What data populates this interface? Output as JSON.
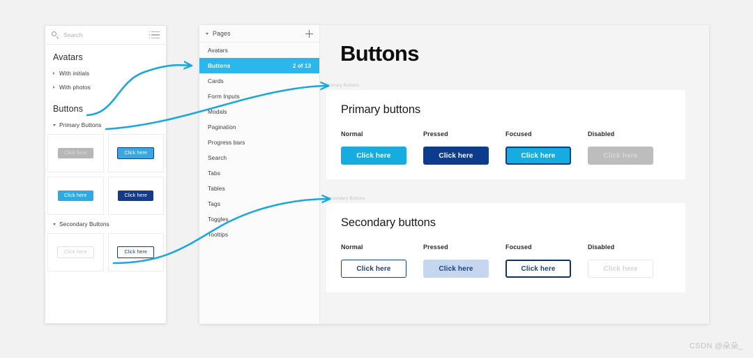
{
  "colors": {
    "accent_cyan": "#16ace0",
    "selected_row": "#2bb6ec",
    "navy": "#0d3c8f",
    "secondary_navy": "#1b3f7e",
    "disabled_gray": "#bdbdbd",
    "arrow": "#1ba7dd",
    "canvas": "#f2f2f2"
  },
  "left_panel": {
    "search": {
      "placeholder": "Search",
      "icon": "search-icon",
      "list_icon": "list-view-icon"
    },
    "groups": [
      {
        "title": "Avatars",
        "items": [
          {
            "label": "With initials",
            "caret": "right"
          },
          {
            "label": "With photos",
            "caret": "right"
          }
        ]
      },
      {
        "title": "Buttons",
        "items": [
          {
            "label": "Primary Buttons",
            "caret": "down"
          },
          {
            "label": "Secondary Buttons",
            "caret": "down"
          }
        ]
      }
    ],
    "thumbnails": {
      "primary": [
        {
          "label": "Click here",
          "state": "disabled"
        },
        {
          "label": "Click here",
          "state": "focused"
        },
        {
          "label": "Click here",
          "state": "normal"
        },
        {
          "label": "Click here",
          "state": "pressed"
        }
      ],
      "secondary": [
        {
          "label": "Click here",
          "state": "disabled"
        },
        {
          "label": "Click here",
          "state": "focused"
        }
      ]
    }
  },
  "pages_pane": {
    "header": {
      "title": "Pages",
      "add_icon": "plus-icon",
      "collapse_icon": "caret-down-icon"
    },
    "items": [
      {
        "label": "Avatars",
        "count": "",
        "selected": false
      },
      {
        "label": "Buttons",
        "count": "2 of 13",
        "selected": true
      },
      {
        "label": "Cards",
        "count": "",
        "selected": false
      },
      {
        "label": "Form Inputs",
        "count": "",
        "selected": false
      },
      {
        "label": "Modals",
        "count": "",
        "selected": false
      },
      {
        "label": "Pagination",
        "count": "",
        "selected": false
      },
      {
        "label": "Progress bars",
        "count": "",
        "selected": false
      },
      {
        "label": "Search",
        "count": "",
        "selected": false
      },
      {
        "label": "Tabs",
        "count": "",
        "selected": false
      },
      {
        "label": "Tables",
        "count": "",
        "selected": false
      },
      {
        "label": "Tags",
        "count": "",
        "selected": false
      },
      {
        "label": "Toggles",
        "count": "",
        "selected": false
      },
      {
        "label": "Tooltips",
        "count": "",
        "selected": false
      }
    ]
  },
  "content": {
    "title": "Buttons",
    "sections": [
      {
        "tag": "Primary Buttons",
        "heading": "Primary buttons",
        "states": [
          {
            "label": "Normal",
            "button": "Click here",
            "style": "p-normal"
          },
          {
            "label": "Pressed",
            "button": "Click here",
            "style": "p-pressed"
          },
          {
            "label": "Focused",
            "button": "Click here",
            "style": "p-focused"
          },
          {
            "label": "Disabled",
            "button": "Click here",
            "style": "p-disabled"
          }
        ]
      },
      {
        "tag": "Secondary Buttons",
        "heading": "Secondary buttons",
        "states": [
          {
            "label": "Normal",
            "button": "Click here",
            "style": "s-normal"
          },
          {
            "label": "Pressed",
            "button": "Click here",
            "style": "s-pressed"
          },
          {
            "label": "Focused",
            "button": "Click here",
            "style": "s-focused"
          },
          {
            "label": "Disabled",
            "button": "Click here",
            "style": "s-disabled"
          }
        ]
      }
    ]
  },
  "annotations": {
    "arrows": [
      {
        "name": "arrow-buttons-to-pages-buttons"
      },
      {
        "name": "arrow-primary-to-primary-section"
      },
      {
        "name": "arrow-secondary-to-secondary-section"
      }
    ]
  },
  "watermark": "CSDN @朵朵_"
}
